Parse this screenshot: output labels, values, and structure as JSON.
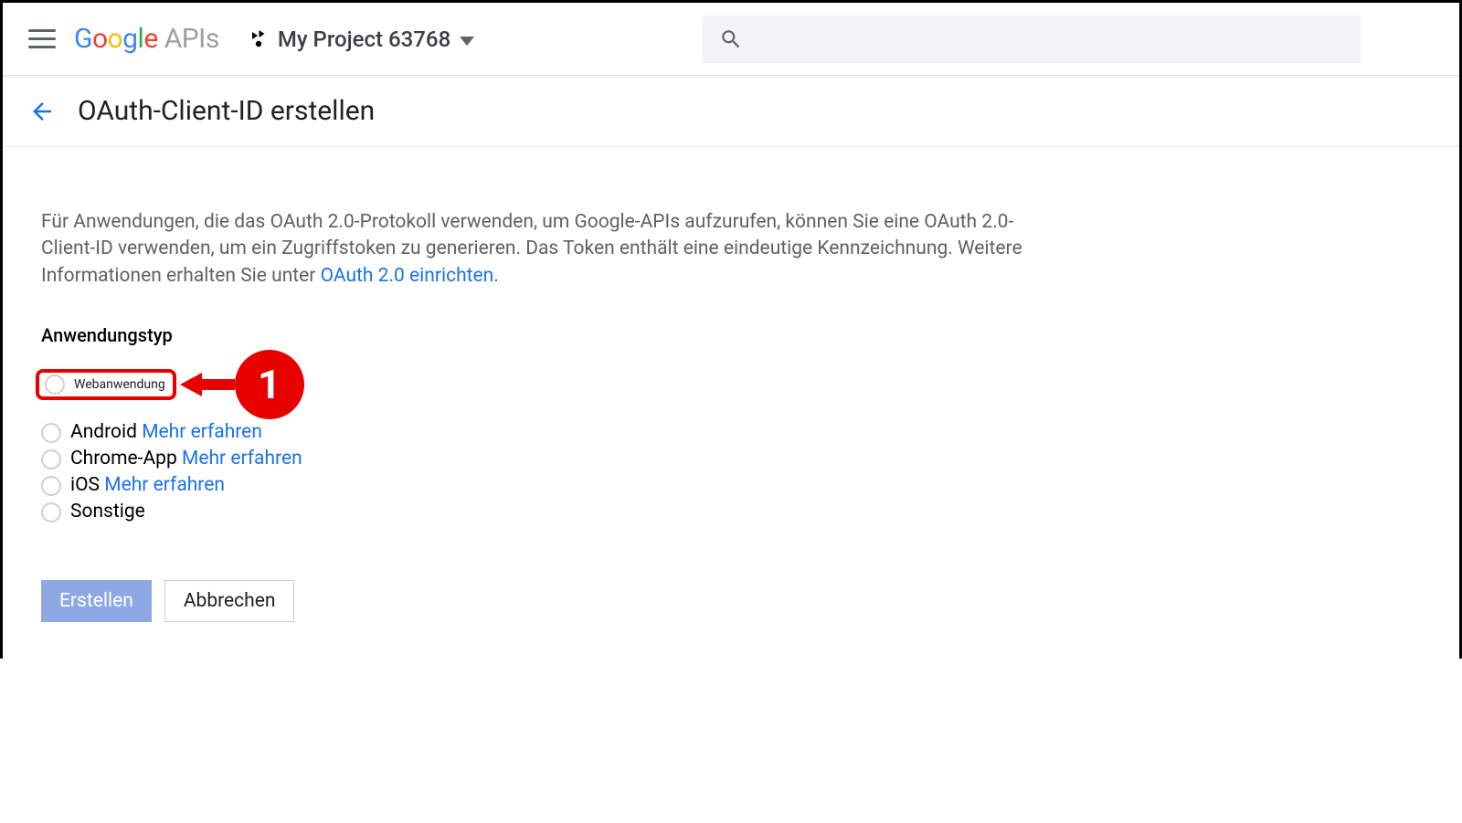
{
  "header": {
    "project_name": "My Project 63768"
  },
  "page": {
    "title": "OAuth-Client-ID erstellen"
  },
  "description": {
    "text_before": "Für Anwendungen, die das OAuth 2.0-Protokoll verwenden, um Google-APIs aufzurufen, können Sie eine OAuth 2.0-Client-ID verwenden, um ein Zugriffstoken zu generieren. Das Token enthält eine eindeutige Kennzeichnung. Weitere Informationen erhalten Sie unter ",
    "link_text": "OAuth 2.0 einrichten",
    "text_after": "."
  },
  "form": {
    "label": "Anwendungstyp",
    "options": [
      {
        "label": "Webanwendung",
        "learn_more": "",
        "highlighted": true
      },
      {
        "label": "Android",
        "learn_more": "Mehr erfahren"
      },
      {
        "label": "Chrome-App",
        "learn_more": "Mehr erfahren"
      },
      {
        "label": "iOS",
        "learn_more": "Mehr erfahren"
      },
      {
        "label": "Sonstige",
        "learn_more": ""
      }
    ]
  },
  "marker": {
    "number": "1"
  },
  "actions": {
    "create": "Erstellen",
    "cancel": "Abbrechen"
  }
}
